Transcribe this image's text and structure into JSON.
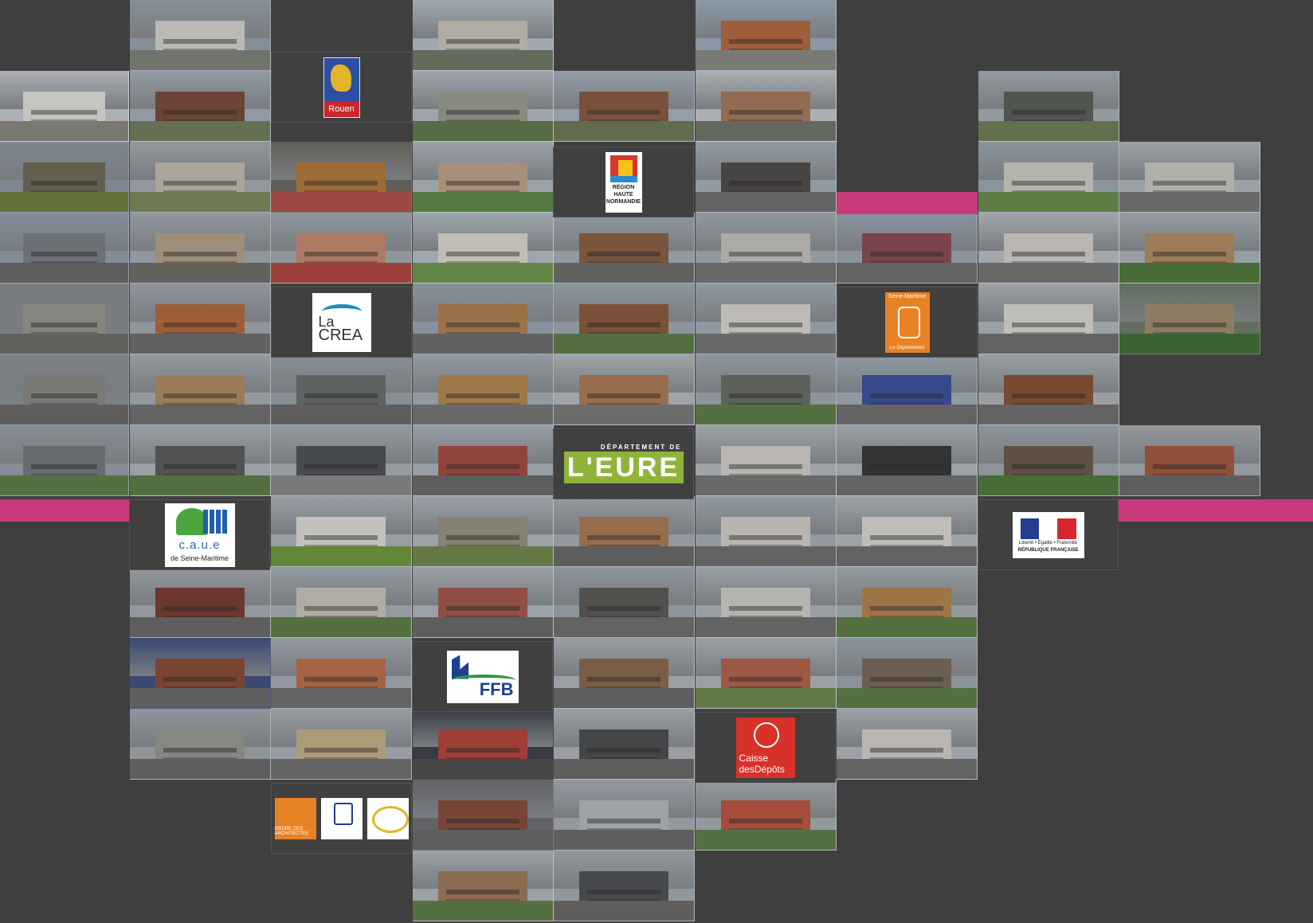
{
  "background_color": "#3f3f3f",
  "accent_color": "#c93a7c",
  "logos": {
    "rouen": {
      "text": "Rouen"
    },
    "region": {
      "line1": "RÉGION",
      "line2": "HAUTE",
      "line3": "NORMANDIE"
    },
    "crea": {
      "line1": "La",
      "line2": "CREA"
    },
    "seine_maritime": {
      "top": "Seine-Maritime",
      "bottom": "Le Département"
    },
    "eure": {
      "top": "DÉPARTEMENT DE",
      "main": "L'EURE"
    },
    "caue": {
      "main": "c.a.u.e",
      "sub": "de Seine-Maritime"
    },
    "republique": {
      "motto": "Liberté • Égalité • Fraternité",
      "name": "RÉPUBLIQUE FRANÇAISE"
    },
    "ffb": {
      "text": "FFB"
    },
    "cdc": {
      "line1": "Caisse",
      "line2": "desDépôts"
    },
    "ordre": {
      "text": "ORDRE DES ARCHITECTES"
    }
  },
  "photo_tiles": [
    {
      "c": 1,
      "r": 0,
      "sky": "#9aa6b2",
      "bldg": "#d8d8d4",
      "ground": "#7f8478"
    },
    {
      "c": 3,
      "r": 0,
      "sky": "#b9c3ce",
      "bldg": "#cfc9bf",
      "ground": "#6f7a66"
    },
    {
      "c": 5,
      "r": 0,
      "sky": "#9fb0c4",
      "bldg": "#b86a3c",
      "ground": "#8c8c86"
    },
    {
      "c": 0,
      "r": 1,
      "sky": "#c9ced3",
      "bldg": "#e6e6e2",
      "ground": "#8a8a80"
    },
    {
      "c": 1,
      "r": 1,
      "sky": "#a9b4bf",
      "bldg": "#7a4a36",
      "ground": "#6f7f5c"
    },
    {
      "c": 3,
      "r": 1,
      "sky": "#b7c0c8",
      "bldg": "#9aa08f",
      "ground": "#5f7a4a"
    },
    {
      "c": 4,
      "r": 1,
      "sky": "#a9b7c6",
      "bldg": "#8a5a3e",
      "ground": "#6b7a55"
    },
    {
      "c": 5,
      "r": 1,
      "sky": "#c8ccd0",
      "bldg": "#a97a5c",
      "ground": "#707468"
    },
    {
      "c": 7,
      "r": 1,
      "sky": "#aab2b8",
      "bldg": "#5a5e58",
      "ground": "#6d7f55"
    },
    {
      "c": 0,
      "r": 2,
      "sky": "#8f9aa6",
      "bldg": "#6f6a56",
      "ground": "#6f7f3e"
    },
    {
      "c": 1,
      "r": 2,
      "sky": "#a9b0b6",
      "bldg": "#c7c0b2",
      "ground": "#7d8a5a"
    },
    {
      "c": 2,
      "r": 2,
      "sky": "#6e6a60",
      "bldg": "#b77a3a",
      "ground": "#b9504a"
    },
    {
      "c": 3,
      "r": 2,
      "sky": "#b4bdc5",
      "bldg": "#c2a58a",
      "ground": "#5f8a45"
    },
    {
      "c": 5,
      "r": 2,
      "sky": "#a9b3bd",
      "bldg": "#4f4a48",
      "ground": "#707070"
    },
    {
      "c": 7,
      "r": 2,
      "sky": "#9eacb8",
      "bldg": "#d5d2cc",
      "ground": "#6a8f4a"
    },
    {
      "c": 8,
      "r": 2,
      "sky": "#b3bcc4",
      "bldg": "#cfccc6",
      "ground": "#777777"
    },
    {
      "c": 0,
      "r": 3,
      "sky": "#93a3b3",
      "bldg": "#7a8088",
      "ground": "#6a6a6a"
    },
    {
      "c": 1,
      "r": 3,
      "sky": "#a6afb8",
      "bldg": "#b8a48c",
      "ground": "#6f6f6a"
    },
    {
      "c": 2,
      "r": 3,
      "sky": "#a4aeb8",
      "bldg": "#c98a72",
      "ground": "#b8453e"
    },
    {
      "c": 3,
      "r": 3,
      "sky": "#b7c2cb",
      "bldg": "#e2ddd3",
      "ground": "#6f9a4c"
    },
    {
      "c": 4,
      "r": 3,
      "sky": "#a8b2bb",
      "bldg": "#8a5e40",
      "ground": "#6d6d68"
    },
    {
      "c": 5,
      "r": 3,
      "sky": "#a7b1ba",
      "bldg": "#c9c6bf",
      "ground": "#777777"
    },
    {
      "c": 6,
      "r": 3,
      "sky": "#9eabb7",
      "bldg": "#8a4a52",
      "ground": "#6f6f6f"
    },
    {
      "c": 7,
      "r": 3,
      "sky": "#bcc2c7",
      "bldg": "#d8d5d0",
      "ground": "#777777"
    },
    {
      "c": 8,
      "r": 3,
      "sky": "#aeb6bd",
      "bldg": "#b88e62",
      "ground": "#4f7a3a"
    },
    {
      "c": 0,
      "r": 4,
      "sky": "#8a8f92",
      "bldg": "#9a9a92",
      "ground": "#6e6f6b"
    },
    {
      "c": 1,
      "r": 4,
      "sky": "#a4adb6",
      "bldg": "#b9683a",
      "ground": "#6e6e6e"
    },
    {
      "c": 3,
      "r": 4,
      "sky": "#9aa8b6",
      "bldg": "#b4804e",
      "ground": "#6e6e6e"
    },
    {
      "c": 4,
      "r": 4,
      "sky": "#a2adb7",
      "bldg": "#8d5a3a",
      "ground": "#5f7e46"
    },
    {
      "c": 5,
      "r": 4,
      "sky": "#a6b1bb",
      "bldg": "#dedbd6",
      "ground": "#777777"
    },
    {
      "c": 7,
      "r": 4,
      "sky": "#b3bbc2",
      "bldg": "#e0ddd6",
      "ground": "#6f6f6f"
    },
    {
      "c": 8,
      "r": 4,
      "sky": "#6e7d6a",
      "bldg": "#a48e6e",
      "ground": "#3f6f32"
    },
    {
      "c": 0,
      "r": 5,
      "sky": "#8c949a",
      "bldg": "#8a8a86",
      "ground": "#6a6a6a"
    },
    {
      "c": 1,
      "r": 5,
      "sky": "#aab2b9",
      "bldg": "#b48e62",
      "ground": "#6f6f6f"
    },
    {
      "c": 2,
      "r": 5,
      "sky": "#9aa5ae",
      "bldg": "#6a6e70",
      "ground": "#6a6a6a"
    },
    {
      "c": 3,
      "r": 5,
      "sky": "#a8b2bb",
      "bldg": "#b88a4e",
      "ground": "#777777"
    },
    {
      "c": 4,
      "r": 5,
      "sky": "#b8bfc5",
      "bldg": "#b27a56",
      "ground": "#7a7a7a"
    },
    {
      "c": 5,
      "r": 5,
      "sky": "#a2adb6",
      "bldg": "#6a6e66",
      "ground": "#5f7f45"
    },
    {
      "c": 6,
      "r": 5,
      "sky": "#a5b2be",
      "bldg": "#3a4fa0",
      "ground": "#6f6f6f"
    },
    {
      "c": 7,
      "r": 5,
      "sky": "#b2b8bc",
      "bldg": "#8a5032",
      "ground": "#6f6f6f"
    },
    {
      "c": 0,
      "r": 6,
      "sky": "#9aa3ab",
      "bldg": "#737a7f",
      "ground": "#5f7f45"
    },
    {
      "c": 1,
      "r": 6,
      "sky": "#b1b9bf",
      "bldg": "#5a5c5c",
      "ground": "#5f7f45"
    },
    {
      "c": 2,
      "r": 6,
      "sky": "#aab3ba",
      "bldg": "#4e5257",
      "ground": "#8a8a8a"
    },
    {
      "c": 3,
      "r": 6,
      "sky": "#aeb8c0",
      "bldg": "#a8483e",
      "ground": "#6a6a6a"
    },
    {
      "c": 5,
      "r": 6,
      "sky": "#b7bec4",
      "bldg": "#d8d5cf",
      "ground": "#777777"
    },
    {
      "c": 6,
      "r": 6,
      "sky": "#b4bbc1",
      "bldg": "#333538",
      "ground": "#6f6f6f"
    },
    {
      "c": 7,
      "r": 6,
      "sky": "#a1abb3",
      "bldg": "#6a5a48",
      "ground": "#4f7a3a"
    },
    {
      "c": 8,
      "r": 6,
      "sky": "#aab0b5",
      "bldg": "#a8583e",
      "ground": "#6a6a6a"
    },
    {
      "c": 2,
      "r": 7,
      "sky": "#aeb7be",
      "bldg": "#e4e2de",
      "ground": "#6f9a3c"
    },
    {
      "c": 3,
      "r": 7,
      "sky": "#b4bcc3",
      "bldg": "#9a9482",
      "ground": "#6f8a4c"
    },
    {
      "c": 4,
      "r": 7,
      "sky": "#a9b3bb",
      "bldg": "#b07c52",
      "ground": "#6a6a6a"
    },
    {
      "c": 5,
      "r": 7,
      "sky": "#a8b2bb",
      "bldg": "#d7d3cc",
      "ground": "#6f6f6f"
    },
    {
      "c": 6,
      "r": 7,
      "sky": "#b8bec3",
      "bldg": "#e0ddd8",
      "ground": "#6f6f6f"
    },
    {
      "c": 1,
      "r": 8,
      "sky": "#a9b0b6",
      "bldg": "#7a3a30",
      "ground": "#6a6a6a"
    },
    {
      "c": 2,
      "r": 8,
      "sky": "#aab3ba",
      "bldg": "#cfcac0",
      "ground": "#5f7f45"
    },
    {
      "c": 3,
      "r": 8,
      "sky": "#b3bbc2",
      "bldg": "#a8564a",
      "ground": "#6a6a6a"
    },
    {
      "c": 4,
      "r": 8,
      "sky": "#a2acb5",
      "bldg": "#5c5a56",
      "ground": "#6f6f6f"
    },
    {
      "c": 5,
      "r": 8,
      "sky": "#b1b8be",
      "bldg": "#d5d2cb",
      "ground": "#6f6f6f"
    },
    {
      "c": 6,
      "r": 8,
      "sky": "#aab3b8",
      "bldg": "#b8864e",
      "ground": "#5f7f45"
    },
    {
      "c": 1,
      "r": 9,
      "sky": "#3f4f82",
      "bldg": "#8a4a32",
      "ground": "#6a6a6a"
    },
    {
      "c": 2,
      "r": 9,
      "sky": "#a9b2ba",
      "bldg": "#c0704a",
      "ground": "#6f6f6f"
    },
    {
      "c": 4,
      "r": 9,
      "sky": "#b1b9c0",
      "bldg": "#8a6a4a",
      "ground": "#6a6a6a"
    },
    {
      "c": 5,
      "r": 9,
      "sky": "#b3bbc1",
      "bldg": "#b8624a",
      "ground": "#6f8a4c"
    },
    {
      "c": 6,
      "r": 9,
      "sky": "#9eaab5",
      "bldg": "#7a6a58",
      "ground": "#5f7f45"
    },
    {
      "c": 1,
      "r": 10,
      "sky": "#a6adb3",
      "bldg": "#9a9a96",
      "ground": "#6a6a6a"
    },
    {
      "c": 2,
      "r": 10,
      "sky": "#aeb5bb",
      "bldg": "#c8b48a",
      "ground": "#6f6f6f"
    },
    {
      "c": 3,
      "r": 10,
      "sky": "#3b3e4a",
      "bldg": "#b8423a",
      "ground": "#4f4f4f"
    },
    {
      "c": 4,
      "r": 10,
      "sky": "#b2b8bd",
      "bldg": "#4a4c4f",
      "ground": "#6a6a6a"
    },
    {
      "c": 6,
      "r": 10,
      "sky": "#b4bbc1",
      "bldg": "#d8d5cf",
      "ground": "#6f6f6f"
    },
    {
      "c": 3,
      "r": 11,
      "sky": "#6f6e73",
      "bldg": "#8a4a3a",
      "ground": "#6a6a6a"
    },
    {
      "c": 4,
      "r": 11,
      "sky": "#a9b2ba",
      "bldg": "#b8bcbf",
      "ground": "#6a6a6a"
    },
    {
      "c": 5,
      "r": 11,
      "sky": "#aab2b8",
      "bldg": "#c0543e",
      "ground": "#5f7f45"
    },
    {
      "c": 3,
      "r": 12,
      "sky": "#b4bbc1",
      "bldg": "#a07a5a",
      "ground": "#5f7f45"
    },
    {
      "c": 4,
      "r": 12,
      "sky": "#a8b0b6",
      "bldg": "#4e5054",
      "ground": "#6a6a6a"
    }
  ]
}
